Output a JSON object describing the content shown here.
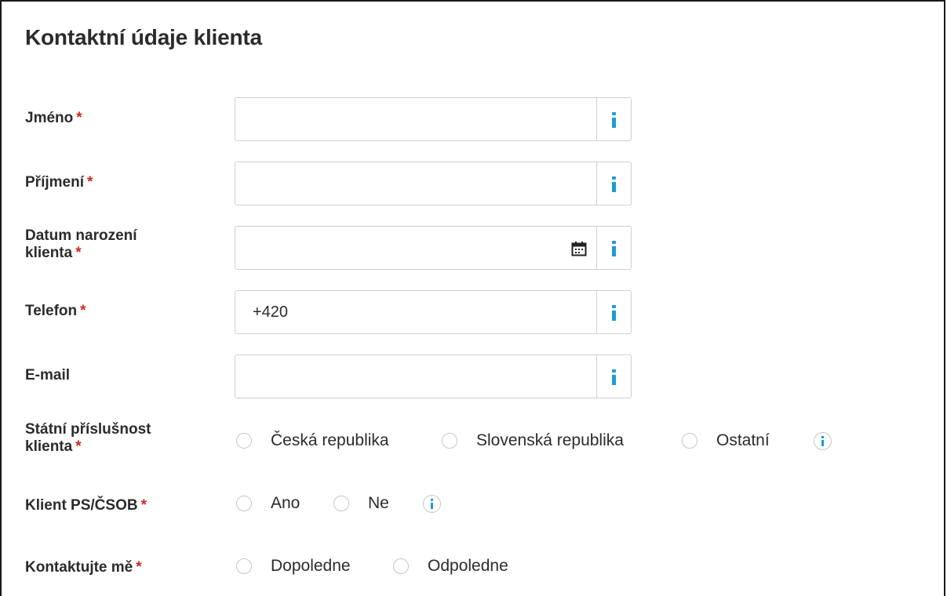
{
  "form": {
    "title": "Kontaktní údaje klienta",
    "required_marker": "*",
    "fields": [
      {
        "label": "Jméno",
        "value": ""
      },
      {
        "label": "Příjmení",
        "value": ""
      },
      {
        "label_line1": "Datum narození",
        "label_line2": "klienta",
        "value": ""
      },
      {
        "label": "Telefon",
        "value": "+420"
      },
      {
        "label": "E-mail",
        "value": ""
      }
    ],
    "citizenship": {
      "label_line1": "Státní příslušnost",
      "label_line2": "klienta",
      "options": [
        "Česká republika",
        "Slovenská republika",
        "Ostatní"
      ]
    },
    "client_ps_csob": {
      "label": "Klient PS/ČSOB",
      "options": [
        "Ano",
        "Ne"
      ]
    },
    "contact_me": {
      "label": "Kontaktujte mě",
      "options": [
        "Dopoledne",
        "Odpoledne"
      ]
    }
  },
  "colors": {
    "required": "#d2281e",
    "info_accent": "#1b9cd4",
    "border": "#d0d0d0",
    "text": "#2b2b2b"
  },
  "icons": {
    "info": "info-icon",
    "calendar": "calendar-icon",
    "radio": "radio-unchecked"
  }
}
